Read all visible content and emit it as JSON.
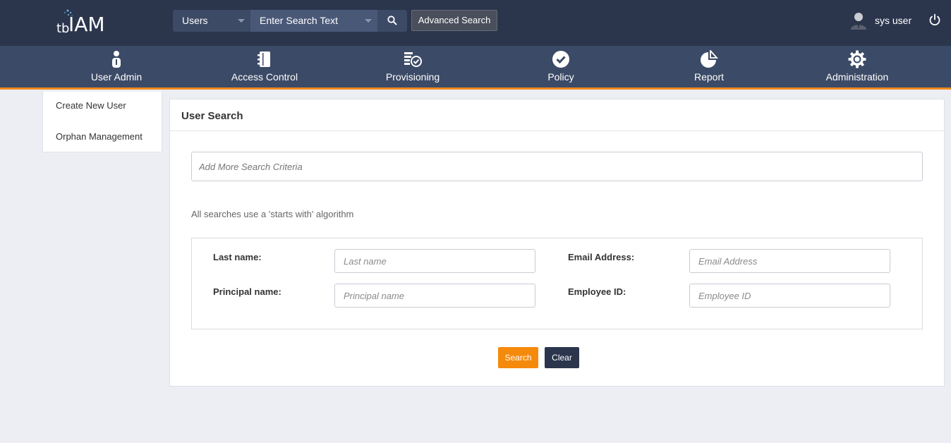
{
  "app": {
    "logo_prefix": "tb",
    "logo_main": "IAM"
  },
  "topbar": {
    "search_type": "Users",
    "search_placeholder": "Enter Search Text",
    "advanced_search_label": "Advanced Search",
    "user_name": "sys user"
  },
  "nav": {
    "items": [
      {
        "label": "User Admin",
        "icon": "user-admin-icon"
      },
      {
        "label": "Access Control",
        "icon": "access-control-icon"
      },
      {
        "label": "Provisioning",
        "icon": "provisioning-icon"
      },
      {
        "label": "Policy",
        "icon": "policy-check-icon"
      },
      {
        "label": "Report",
        "icon": "report-pie-icon"
      },
      {
        "label": "Administration",
        "icon": "gear-icon"
      }
    ]
  },
  "sidebar": {
    "items": [
      {
        "label": "Create New User"
      },
      {
        "label": "Orphan Management"
      }
    ]
  },
  "main": {
    "title": "User Search",
    "criteria_placeholder": "Add More Search Criteria",
    "hint": "All searches use a 'starts with' algorithm",
    "fields": {
      "last_name": {
        "label": "Last name:",
        "placeholder": "Last name"
      },
      "email": {
        "label": "Email Address:",
        "placeholder": "Email Address"
      },
      "principal": {
        "label": "Principal name:",
        "placeholder": "Principal name"
      },
      "employee_id": {
        "label": "Employee ID:",
        "placeholder": "Employee ID"
      }
    },
    "search_label": "Search",
    "clear_label": "Clear"
  },
  "colors": {
    "topbar": "#2b364d",
    "navbar": "#3b4a66",
    "accent": "#f08a1c",
    "search_button": "#f5890c"
  }
}
